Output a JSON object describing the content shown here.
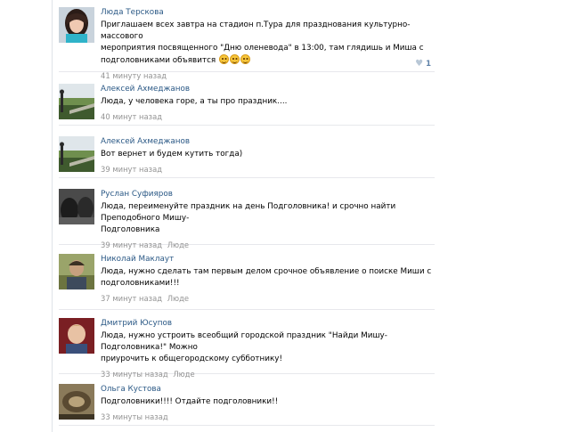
{
  "comments": [
    {
      "author": "Люда Терскова",
      "text_lines": [
        "Приглашаем всех завтра на стадион п.Тура для празднования культурно-массового",
        "мероприятия посвященного \"Дню оленевода\" в 13:00, там глядишь и Миша с",
        "подголовниками объявится"
      ],
      "emoji_count": 3,
      "time": "41 минуту назад",
      "reply_to": "",
      "likes": "1",
      "avatar_icon": "girl-avatar"
    },
    {
      "author": "Алексей Ахмеджанов",
      "text_lines": [
        "Люда, у человека горе, а ты про праздник...."
      ],
      "time": "40 минут назад",
      "reply_to": "",
      "avatar_icon": "landscape-avatar"
    },
    {
      "author": "Алексей Ахмеджанов",
      "text_lines": [
        "Вот вернет и будем кутить тогда)"
      ],
      "time": "39 минут назад",
      "reply_to": "",
      "avatar_icon": "landscape-avatar"
    },
    {
      "author": "Руслан Суфияров",
      "text_lines": [
        "Люда, переименуйте праздник на день Подголовника! и срочно найти Преподобного Мишу-",
        "Подголовника"
      ],
      "time": "39 минут назад",
      "reply_to": "Люде",
      "avatar_icon": "dark-photo-avatar"
    },
    {
      "author": "Николай Маклаут",
      "text_lines": [
        "Люда, нужно сделать там первым делом срочное объявление о поиске Миши с",
        "подголовниками!!!"
      ],
      "time": "37 минут назад",
      "reply_to": "Люде",
      "avatar_icon": "man-avatar"
    },
    {
      "author": "Дмитрий Юсупов",
      "text_lines": [
        "Люда, нужно устроить всеобщий городской праздник \"Найди Мишу-Подголовника!\" Можно",
        "приурочить к общегородскому субботнику!"
      ],
      "time": "33 минуты назад",
      "reply_to": "Люде",
      "avatar_icon": "child-avatar"
    },
    {
      "author": "Ольга Кустова",
      "text_lines": [
        "Подголовники!!!! Отдайте подголовники!!"
      ],
      "time": "33 минуты назад",
      "reply_to": "",
      "avatar_icon": "ornament-avatar"
    }
  ],
  "colors": {
    "author": "#2a5885",
    "meta": "#939393",
    "divider": "#e7e8ec",
    "like_count": "#5e81a8"
  }
}
